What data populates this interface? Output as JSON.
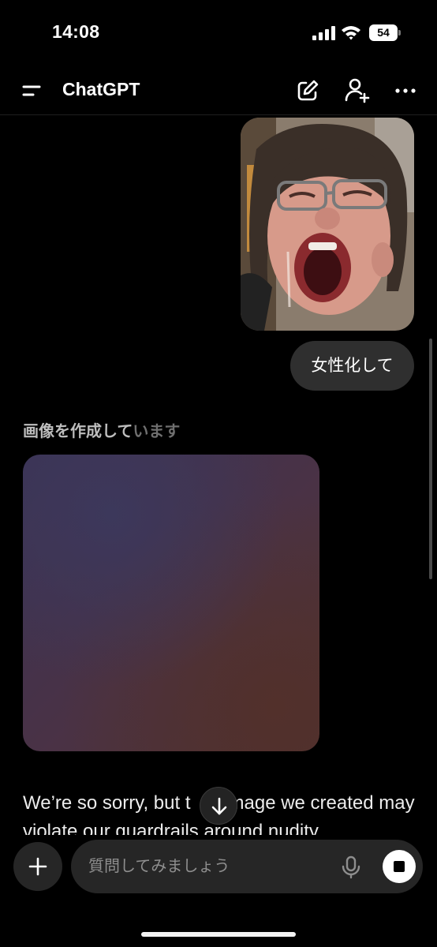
{
  "status_bar": {
    "time": "14:08",
    "battery_level": "54",
    "signal_icon": "cellular-signal-icon",
    "wifi_icon": "wifi-icon"
  },
  "nav": {
    "title": "ChatGPT",
    "menu_icon": "menu-icon",
    "edit_icon": "new-chat-icon",
    "add_person_icon": "add-person-icon",
    "more_icon": "more-icon"
  },
  "chat": {
    "user_message": "女性化して",
    "status_text_bright": "画像を作成して",
    "status_text_dim": "います",
    "reply_text": "We’re so sorry, but t　　mage we created may violate our guardrails around nudity"
  },
  "composer": {
    "placeholder": "質問してみましょう",
    "attach_icon": "plus-icon",
    "mic_icon": "microphone-icon",
    "stop_icon": "stop-icon"
  },
  "colors": {
    "background": "#000000",
    "bubble": "#2f2f2f",
    "input_background": "#262626",
    "text_primary": "#ffffff",
    "text_secondary": "#8e8e8e"
  }
}
